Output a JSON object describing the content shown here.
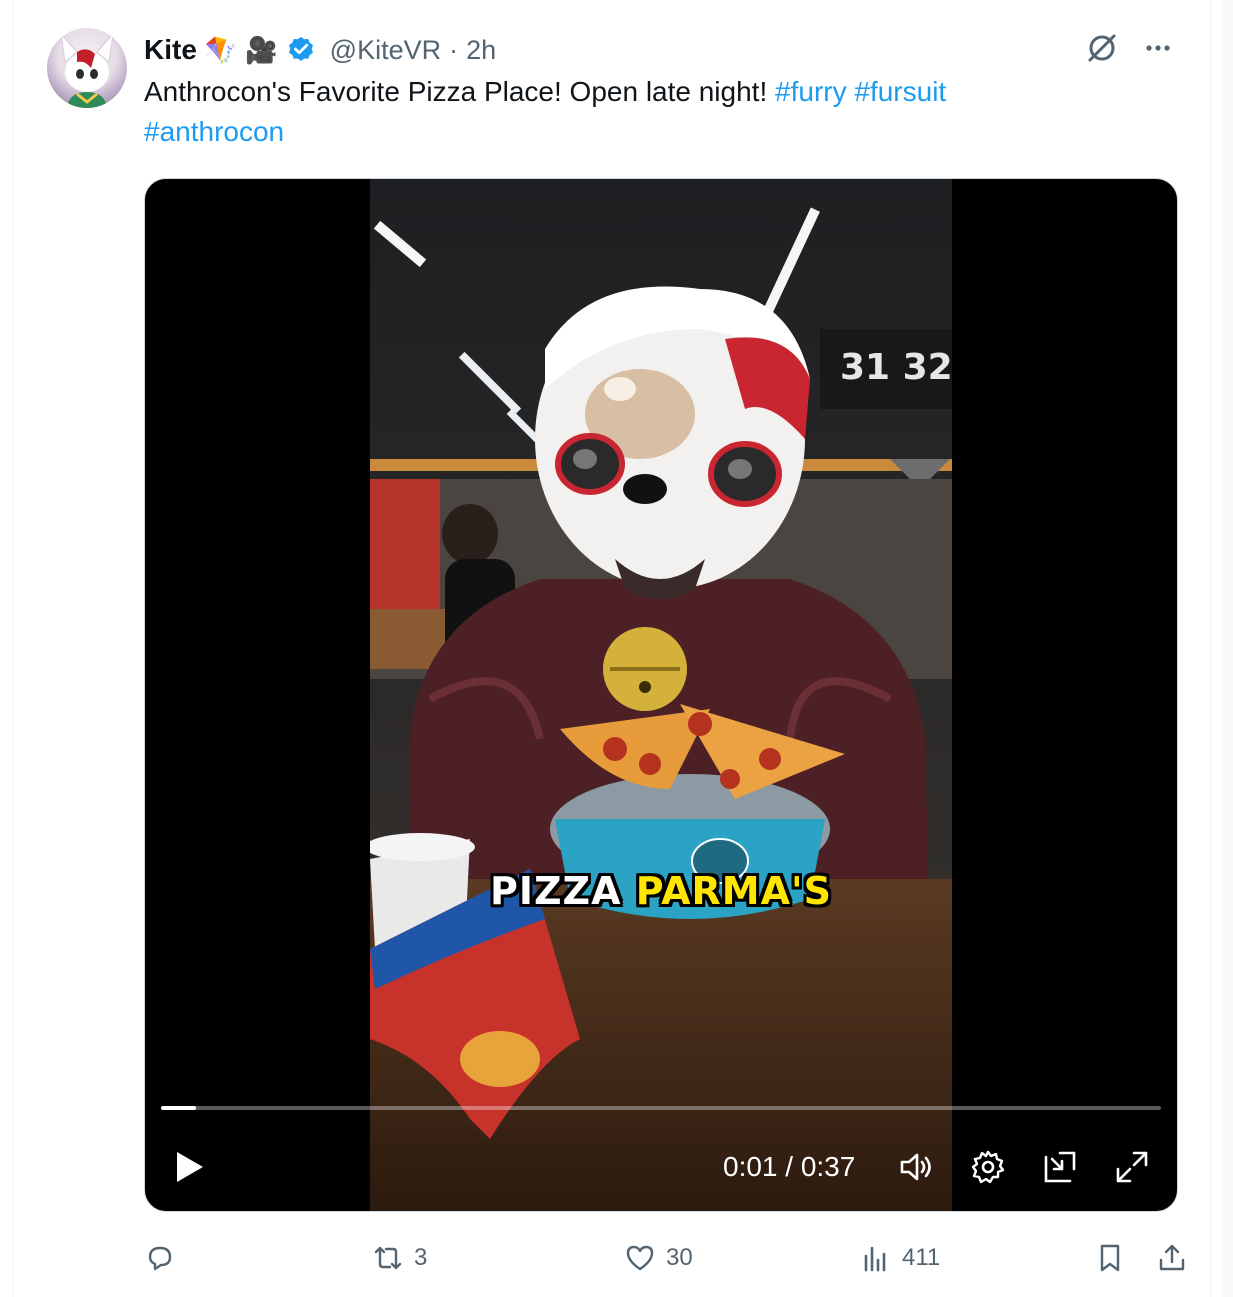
{
  "tweet": {
    "author_name": "Kite",
    "emojis": [
      "🪁",
      "🎥"
    ],
    "handle": "@KiteVR",
    "separator": "·",
    "time": "2h",
    "text_plain": "Anthrocon's Favorite Pizza Place! Open late night! ",
    "hashtags": [
      "#furry",
      "#fursuit",
      "#anthrocon"
    ]
  },
  "video": {
    "caption_white": "PIZZA",
    "caption_yellow": "PARMA'S",
    "time_display": "0:01 / 0:37",
    "progress_fraction": 0.035
  },
  "actions": {
    "reply_count": "",
    "retweet_count": "3",
    "like_count": "30",
    "views_count": "411"
  },
  "colors": {
    "accent": "#1d9bf0",
    "muted": "#536471",
    "caption_yellow": "#ffe600"
  },
  "icons": {
    "verified": "verified-badge-icon",
    "grok": "grok-icon",
    "more": "more-icon",
    "play": "play-icon",
    "volume": "volume-icon",
    "settings": "gear-icon",
    "pip": "pip-icon",
    "fullscreen": "fullscreen-icon",
    "reply": "reply-icon",
    "retweet": "retweet-icon",
    "like": "heart-icon",
    "views": "views-icon",
    "bookmark": "bookmark-icon",
    "share": "share-icon"
  }
}
